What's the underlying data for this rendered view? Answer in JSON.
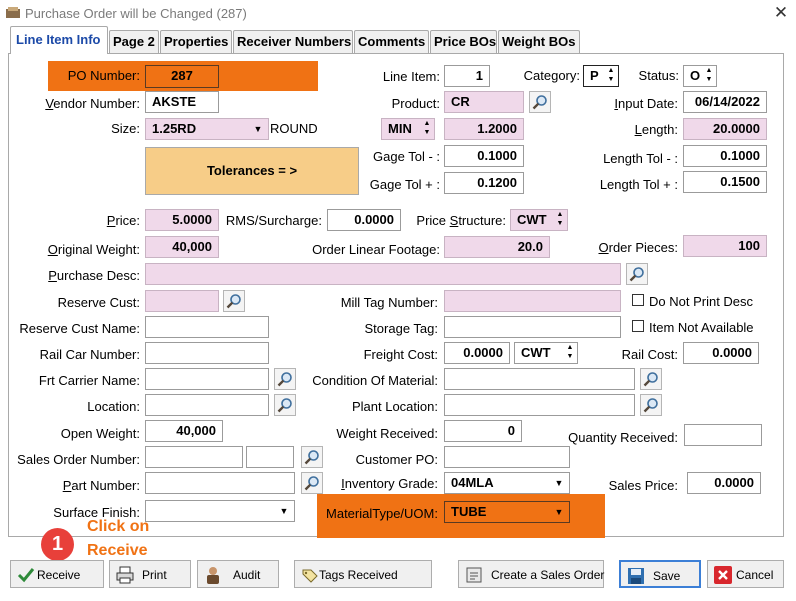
{
  "window": {
    "title": "Purchase Order will be Changed  (287)",
    "close_glyph": "✕"
  },
  "tabs": [
    "Line Item Info",
    "Page 2",
    "Properties",
    "Receiver Numbers",
    "Comments",
    "Price BOs",
    "Weight BOs"
  ],
  "form": {
    "po_number_label": "PO Number:",
    "po_number": "287",
    "vendor_number_label": "Vendor Number:",
    "vendor_number": "AKSTE",
    "size_label": "Size:",
    "size": "1.25RD",
    "size_suffix": "ROUND",
    "tolerances_button": "Tolerances = >",
    "line_item_label": "Line Item:",
    "line_item": "1",
    "category_label": "Category:",
    "category": "P",
    "status_label": "Status:",
    "status": "O",
    "product_label": "Product:",
    "product": "CR",
    "input_date_label": "Input Date:",
    "input_date": "06/14/2022",
    "unit": "MIN",
    "unit_value": "1.2000",
    "length_label": "Length:",
    "length": "20.0000",
    "gage_tol_minus_label": "Gage Tol - :",
    "gage_tol_minus": "0.1000",
    "length_tol_minus_label": "Length Tol - :",
    "length_tol_minus": "0.1000",
    "gage_tol_plus_label": "Gage Tol + :",
    "gage_tol_plus": "0.1200",
    "length_tol_plus_label": "Length Tol + :",
    "length_tol_plus": "0.1500",
    "price_label": "Price:",
    "price": "5.0000",
    "rms_label": "RMS/Surcharge:",
    "rms": "0.0000",
    "price_structure_label": "Price Structure:",
    "price_structure": "CWT",
    "original_weight_label": "Original Weight:",
    "original_weight": "40,000",
    "order_linear_footage_label": "Order Linear Footage:",
    "order_linear_footage": "20.0",
    "order_pieces_label": "Order Pieces:",
    "order_pieces": "100",
    "purchase_desc_label": "Purchase Desc:",
    "purchase_desc": "",
    "reserve_cust_label": "Reserve Cust:",
    "reserve_cust": "",
    "mill_tag_label": "Mill Tag Number:",
    "mill_tag": "",
    "do_not_print_desc": "Do Not Print Desc",
    "reserve_cust_name_label": "Reserve Cust Name:",
    "reserve_cust_name": "",
    "storage_tag_label": "Storage Tag:",
    "storage_tag": "",
    "item_not_available": "Item Not Available",
    "rail_car_label": "Rail Car Number:",
    "rail_car": "",
    "freight_cost_label": "Freight Cost:",
    "freight_cost": "0.0000",
    "freight_unit": "CWT",
    "rail_cost_label": "Rail Cost:",
    "rail_cost": "0.0000",
    "frt_carrier_label": "Frt Carrier Name:",
    "frt_carrier": "",
    "condition_label": "Condition Of Material:",
    "condition": "",
    "location_label": "Location:",
    "location": "",
    "plant_location_label": "Plant Location:",
    "plant_location": "",
    "open_weight_label": "Open Weight:",
    "open_weight": "40,000",
    "weight_received_label": "Weight Received:",
    "weight_received": "0",
    "quantity_received_label": "Quantity Received:",
    "quantity_received": "",
    "sales_order_label": "Sales Order Number:",
    "sales_order": "",
    "sales_order_2": "",
    "customer_po_label": "Customer PO:",
    "customer_po": "",
    "part_number_label": "Part Number:",
    "part_number": "",
    "inventory_grade_label": "Inventory Grade:",
    "inventory_grade": "04MLA",
    "sales_price_label": "Sales Price:",
    "sales_price": "0.0000",
    "surface_finish_label": "Surface Finish:",
    "surface_finish": "",
    "material_type_label": "MaterialType/UOM:",
    "material_type": "TUBE"
  },
  "callout": {
    "number": "1",
    "line1": "Click on",
    "line2": "Receive"
  },
  "buttons": {
    "receive": "Receive",
    "print": "Print",
    "audit": "Audit",
    "tags_received": "Tags Received",
    "create_sales_order": "Create a Sales Order",
    "save": "Save",
    "cancel": "Cancel"
  },
  "colors": {
    "accent_orange": "#f07214",
    "pink_field": "#f0d9ea",
    "tolerance_button": "#f7cd88",
    "callout_red": "#e8403a",
    "callout_text": "#f07214",
    "tab_active_text": "#1c4aa8"
  }
}
